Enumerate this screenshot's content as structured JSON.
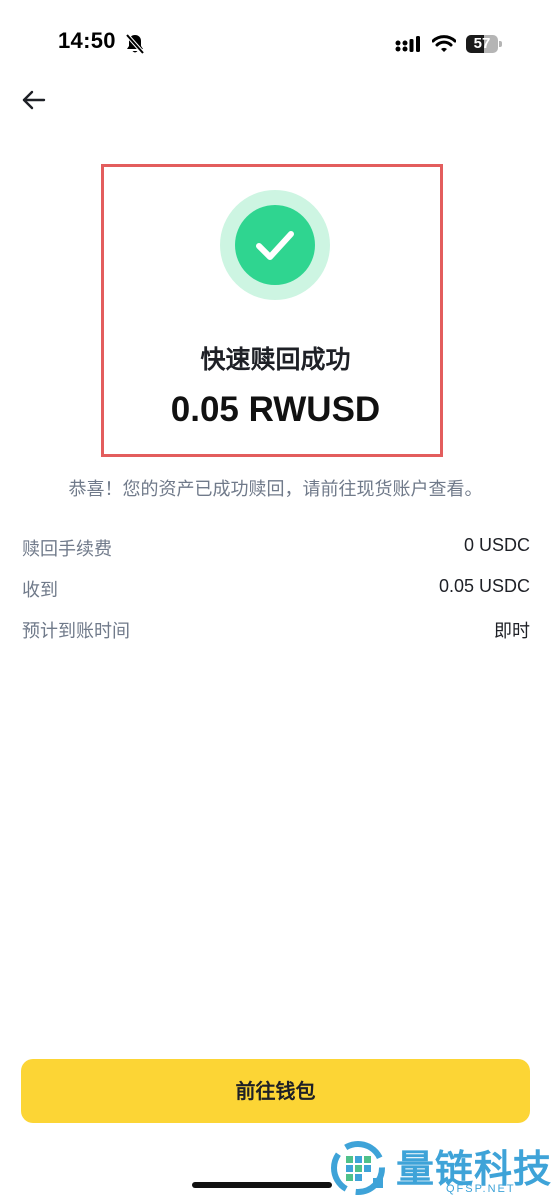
{
  "status_bar": {
    "time": "14:50",
    "battery": "57",
    "battery_level": 0.57,
    "icons": [
      "bell-muted-icon",
      "cellular-signal-icon",
      "wifi-icon",
      "battery-icon"
    ]
  },
  "nav": {
    "back_icon": "arrow-left-icon"
  },
  "result": {
    "icon": "check-circle-icon",
    "title": "快速赎回成功",
    "amount": "0.05 RWUSD",
    "message": "恭喜！您的资产已成功赎回，请前往现货账户查看。"
  },
  "details": [
    {
      "label": "赎回手续费",
      "value": "0 USDC"
    },
    {
      "label": "收到",
      "value": "0.05 USDC"
    },
    {
      "label": "预计到账时间",
      "value": "即时"
    }
  ],
  "actions": {
    "primary_label": "前往钱包"
  },
  "watermark": {
    "title": "量链科技",
    "subtitle": "QFSP.NET"
  },
  "colors": {
    "accent": "#fcd535",
    "success": "#2fd590",
    "success_halo": "#cdf5e2",
    "highlight": "#e35d5d",
    "text_secondary": "#707a8a",
    "watermark": "#3ea3d8"
  }
}
